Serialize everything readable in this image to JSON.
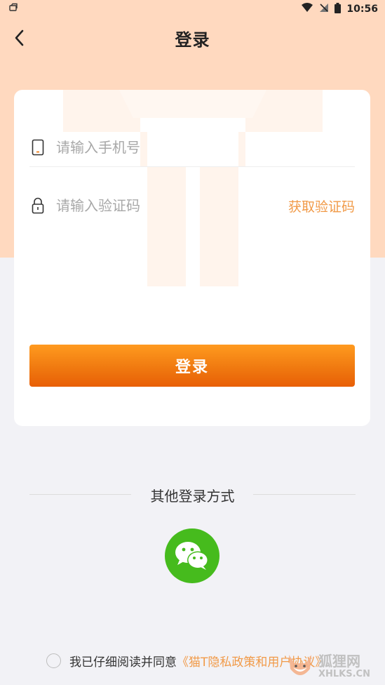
{
  "status_bar": {
    "time": "10:56",
    "icons": [
      "notification-icon",
      "wifi-icon",
      "no-sim-icon",
      "battery-icon"
    ]
  },
  "header": {
    "title": "登录",
    "back_icon": "chevron-left-icon"
  },
  "form": {
    "phone": {
      "icon": "phone-icon",
      "placeholder": "请输入手机号",
      "value": ""
    },
    "code": {
      "icon": "lock-icon",
      "placeholder": "请输入验证码",
      "value": "",
      "get_code_label": "获取验证码"
    },
    "login_label": "登录"
  },
  "other_login": {
    "title": "其他登录方式",
    "wechat_icon": "wechat-icon"
  },
  "agreement": {
    "prefix": "我已仔细阅读并同意",
    "link": "《猫T隐私政策和用户协议》",
    "checked": false
  },
  "watermark_overlay": {
    "text_cn": "狐狸网",
    "text_en": "XHLKS.CN"
  },
  "colors": {
    "accent": "#f19a48",
    "button_top": "#ff9a1f",
    "button_bottom": "#e85f06",
    "hero_bg": "#ffd9bf",
    "wechat": "#46bb1d",
    "page_bg": "#f2f2f6"
  }
}
